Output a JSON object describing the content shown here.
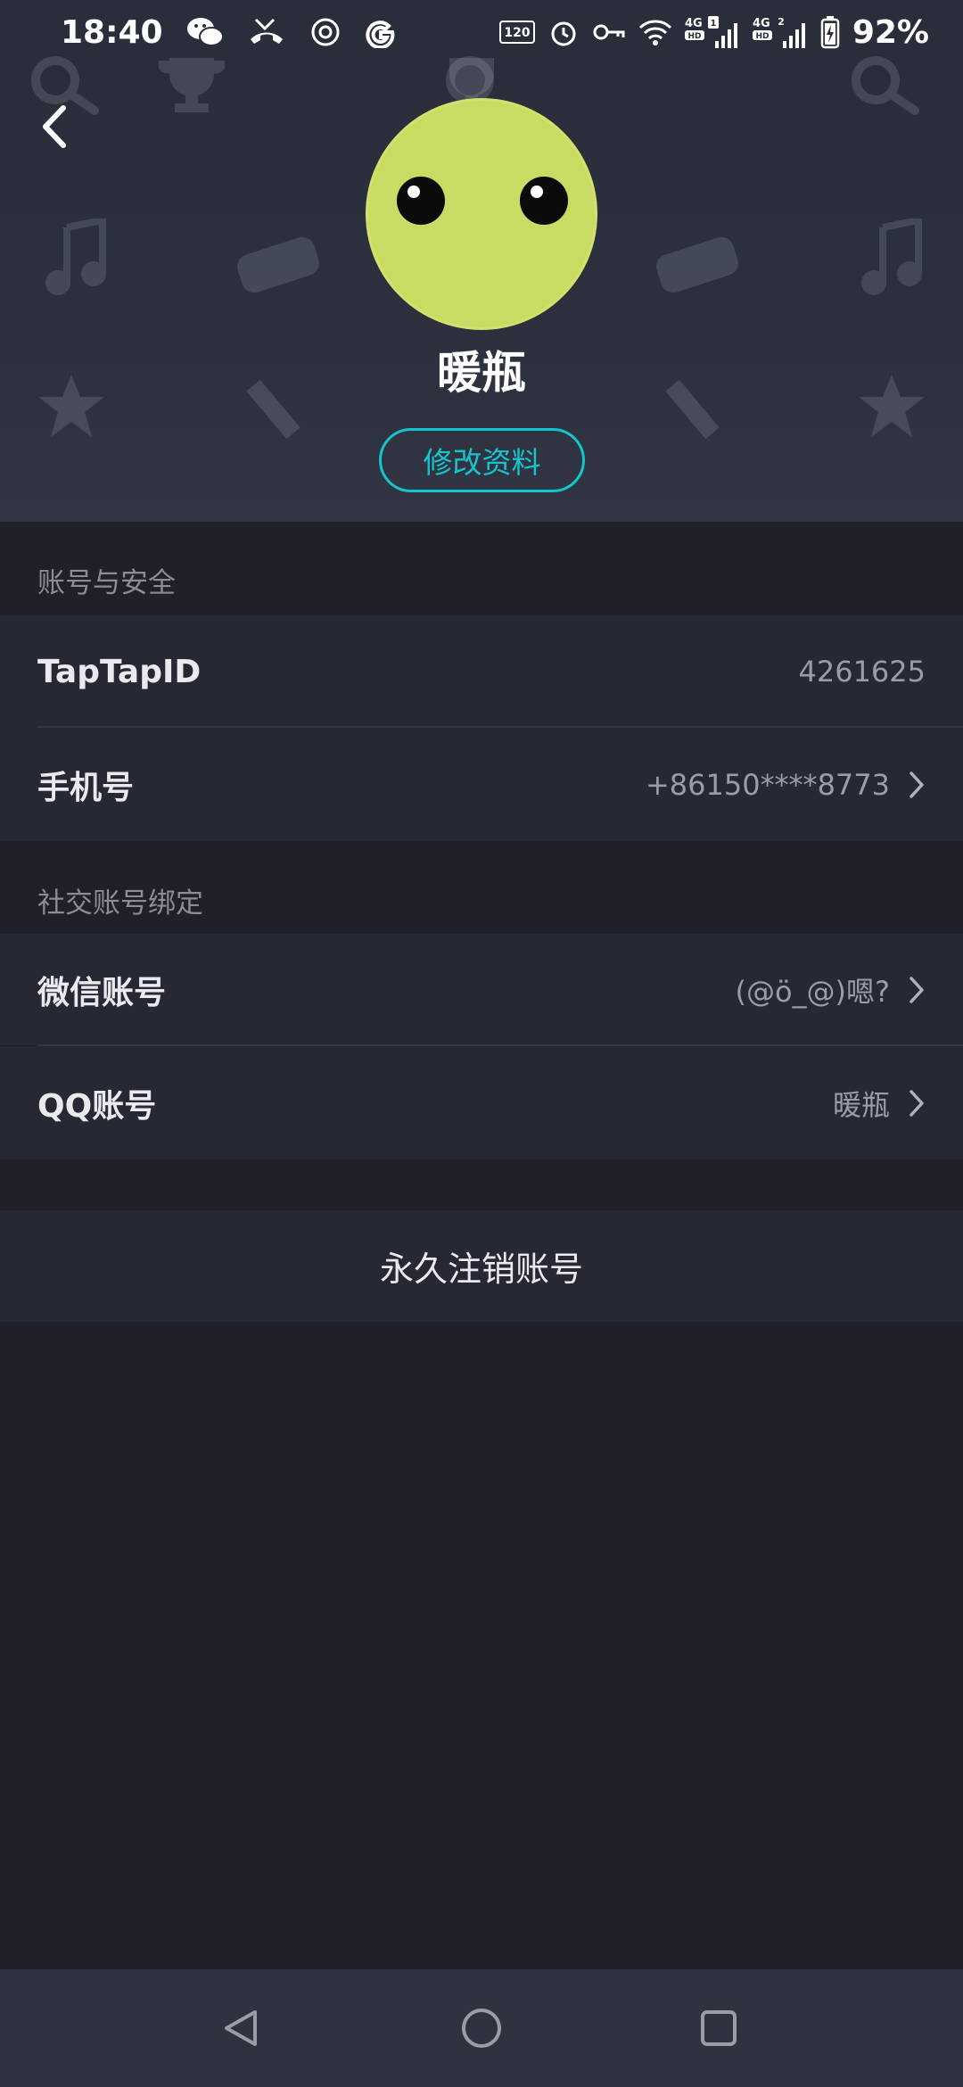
{
  "status_bar": {
    "time": "18:40",
    "refresh_rate": "120",
    "signal1_label": "4G",
    "signal1_sub": "HD",
    "sim1_badge": "1",
    "signal2_label": "4G",
    "signal2_sub": "HD",
    "sim2_badge": "2",
    "battery": "92%"
  },
  "profile": {
    "username": "暖瓶",
    "edit_button": "修改资料"
  },
  "account_security": {
    "section_title": "账号与安全",
    "taptap_id_label": "TapTapID",
    "taptap_id_value": "4261625",
    "phone_label": "手机号",
    "phone_value": "+86150****8773"
  },
  "social_binding": {
    "section_title": "社交账号绑定",
    "wechat_label": "微信账号",
    "wechat_value": "(@ö_@)嗯?",
    "qq_label": "QQ账号",
    "qq_value": "暖瓶"
  },
  "delete_account": {
    "label": "永久注销账号"
  },
  "colors": {
    "accent": "#15c5ce",
    "avatar": "#c8db63",
    "background": "#1f2029",
    "row": "#262834"
  },
  "icons": {
    "back": "back-arrow-icon",
    "chevron": "chevron-right-icon",
    "nav_back": "nav-back-triangle-icon",
    "nav_home": "nav-home-circle-icon",
    "nav_recents": "nav-recents-square-icon"
  }
}
